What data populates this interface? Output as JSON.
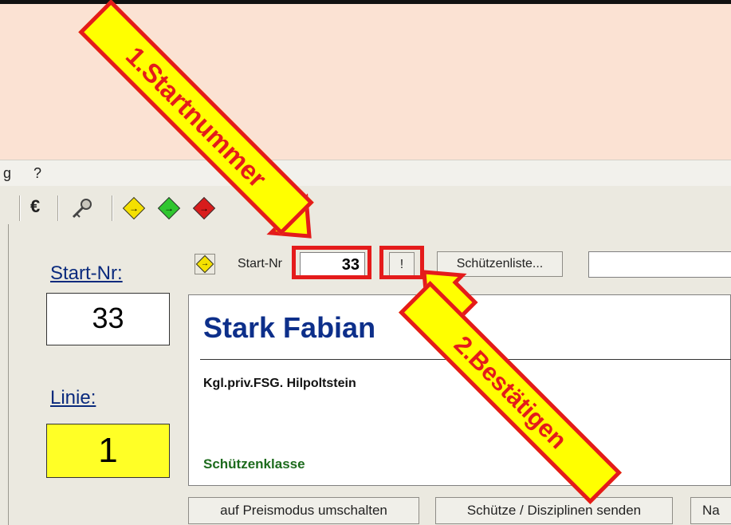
{
  "menu": {
    "items": [
      "g",
      "?"
    ]
  },
  "toolbar": {
    "euro_label": "€",
    "buttons": [
      {
        "icon": "euro-icon"
      },
      {
        "icon": "key-icon"
      },
      {
        "icon": "yellow-arrow-diamond-icon"
      },
      {
        "icon": "green-arrow-diamond-icon"
      },
      {
        "icon": "red-arrow-diamond-icon"
      }
    ]
  },
  "left_panel": {
    "start_label": "Start-Nr:",
    "start_value": "33",
    "linie_label": "Linie:",
    "linie_value": "1"
  },
  "entry": {
    "startnr_label": "Start-Nr",
    "startnr_value": "33",
    "confirm_label": "!",
    "list_button": "Schützenliste...",
    "search_value": ""
  },
  "details": {
    "name": "Stark Fabian",
    "club": "Kgl.priv.FSG. Hilpoltstein",
    "class": "Schützenklasse"
  },
  "bottom_buttons": [
    "auf Preismodus umschalten",
    "Schütze / Disziplinen senden",
    "Na"
  ],
  "annotations": {
    "callout_1": "1.Startnummer",
    "callout_2": "2.Bestätigen"
  },
  "colors": {
    "background": "#fbe2d3",
    "callout_fill": "#ffff00",
    "callout_border": "#e41b1b",
    "linie_box": "#ffff26",
    "name_text": "#0d2f8a",
    "class_text": "#1d6b1d"
  }
}
